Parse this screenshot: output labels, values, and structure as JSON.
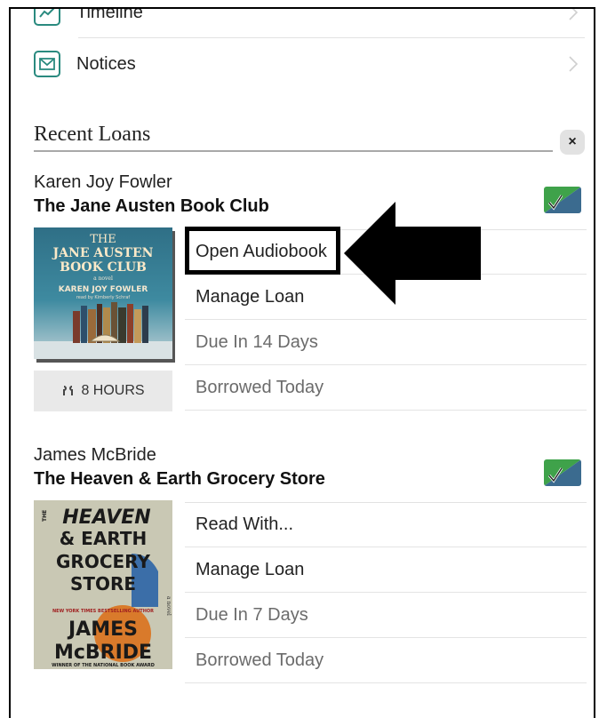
{
  "menu": {
    "timeline_label": "Timeline",
    "notices_label": "Notices"
  },
  "recent_loans": {
    "title": "Recent Loans",
    "close_label": "×"
  },
  "loans": [
    {
      "author": "Karen Joy Fowler",
      "title": "The Jane Austen Book Club",
      "cover": {
        "title_lines": [
          "THE",
          "JANE AUSTEN",
          "BOOK CLUB"
        ],
        "subtitle": "a novel",
        "author": "KAREN JOY FOWLER",
        "narrator": "read by Kimberly Schraf"
      },
      "duration": "8 HOURS",
      "actions": [
        "Open Audiobook",
        "Manage Loan",
        "Due In 14 Days",
        "Borrowed Today"
      ]
    },
    {
      "author": "James McBride",
      "title": "The Heaven & Earth Grocery Store",
      "cover": {
        "title_lines": [
          "HEAVEN",
          "& EARTH",
          "GROCERY",
          "STORE"
        ],
        "the": "THE",
        "tagline": "NEW YORK TIMES BESTSELLING AUTHOR",
        "author_lines": [
          "JAMES",
          "McBRIDE"
        ],
        "award": "WINNER OF THE NATIONAL BOOK AWARD",
        "novel": "a novel"
      },
      "actions": [
        "Read With...",
        "Manage Loan",
        "Due In 7 Days",
        "Borrowed Today"
      ]
    }
  ],
  "colors": {
    "accent": "#2a8a7f",
    "badge_green": "#3fa24a",
    "badge_blue": "#3b6b8f"
  }
}
